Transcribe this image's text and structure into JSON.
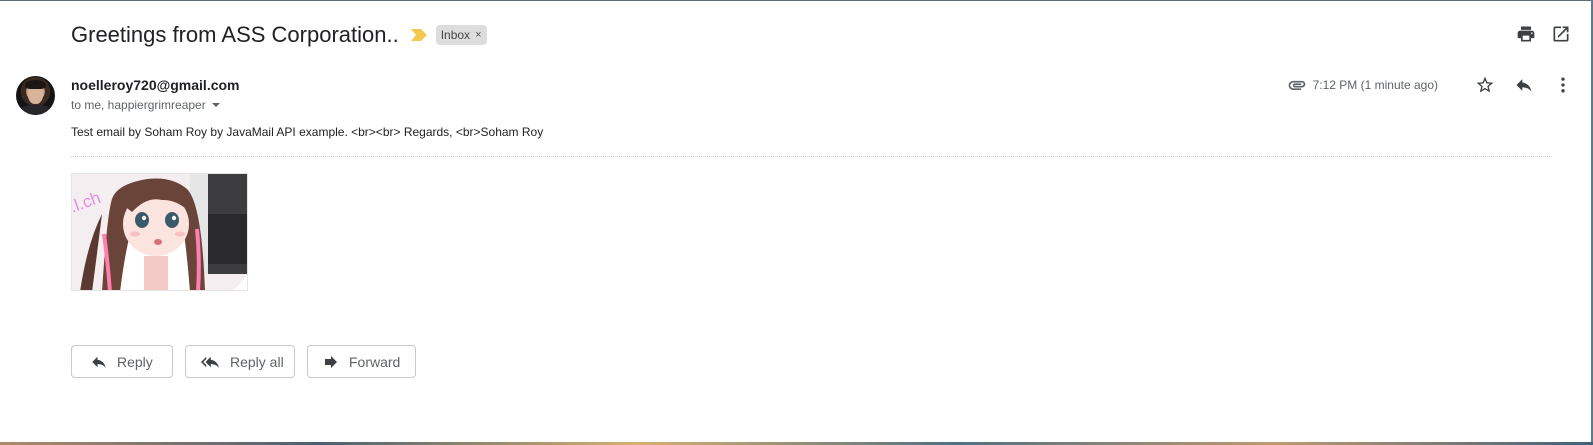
{
  "email": {
    "subject": "Greetings from ASS Corporation..",
    "label": "Inbox",
    "label_remove": "×",
    "sender": "noelleroy720@gmail.com",
    "recipients": "to me, happiergrimreaper",
    "time": "7:12 PM (1 minute ago)",
    "body": "Test email by Soham Roy by JavaMail API example. <br><br> Regards, <br>Soham Roy",
    "attachment_watermark": ".l.ch"
  },
  "actions": {
    "reply": "Reply",
    "reply_all": "Reply all",
    "forward": "Forward"
  },
  "icons": {
    "print": "printer-icon",
    "open_new_window": "open-in-new-icon",
    "attachment": "paperclip-icon",
    "star": "star-outline-icon",
    "reply": "reply-icon",
    "more": "more-vertical-icon"
  },
  "colors": {
    "importance_marker": "#f4c94f",
    "label_chip_bg": "#dddddd"
  }
}
